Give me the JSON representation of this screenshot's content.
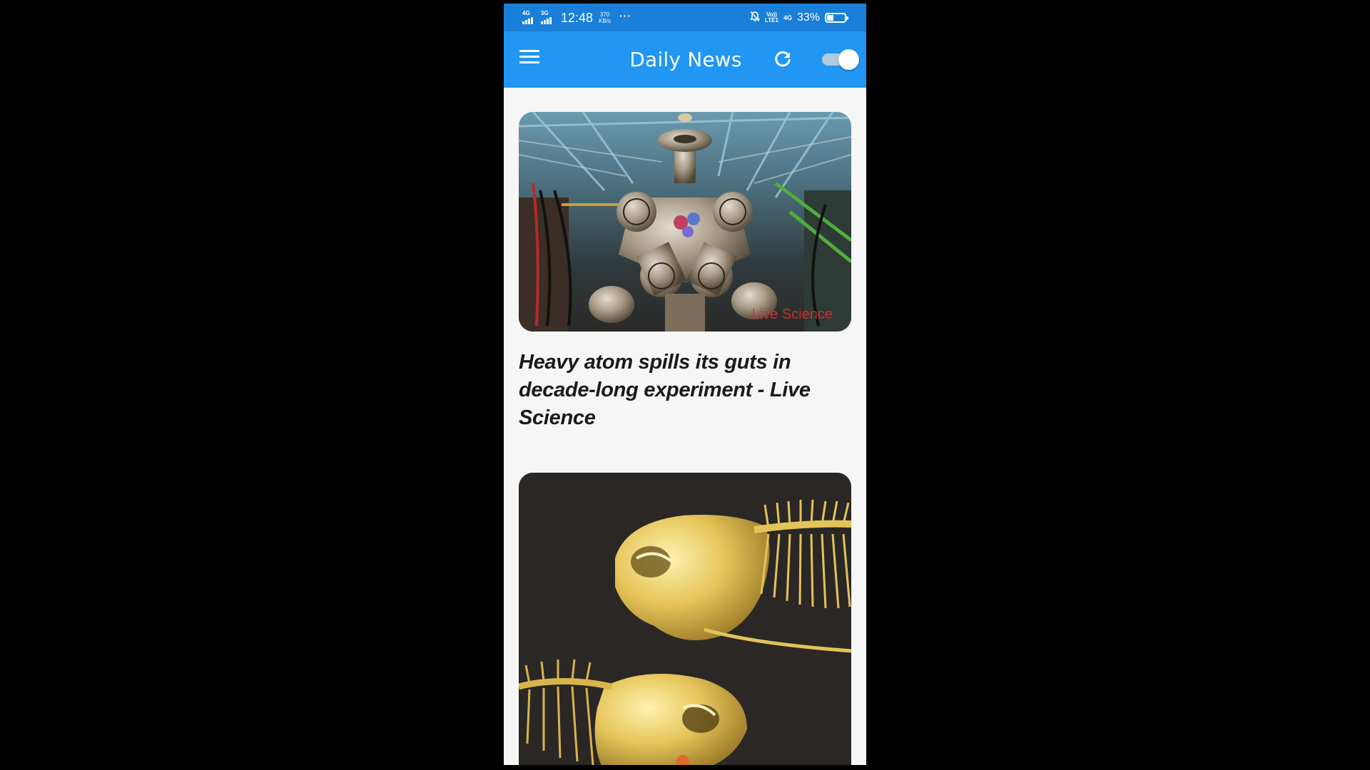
{
  "status_bar": {
    "signal_1_net": "4G",
    "signal_2_net": "3G",
    "time": "12:48",
    "speed_value": "370",
    "speed_unit": "KB/s",
    "more": "···",
    "volte_top": "Vo))",
    "volte_bottom": "LTE1",
    "net_type": "4G",
    "battery_percent": "33%",
    "battery_level": 0.33
  },
  "app_bar": {
    "title": "Daily News",
    "menu_icon": "menu-icon",
    "refresh_icon": "refresh-icon",
    "toggle_state": "on"
  },
  "feed": {
    "articles": [
      {
        "headline": "Heavy atom spills its guts in decade-long experiment - Live Science",
        "image_watermark": "Live Science",
        "image_subject": "particle-detector-photo"
      },
      {
        "headline": "",
        "image_subject": "golden-fish-skeleton-scan"
      }
    ]
  },
  "colors": {
    "status_bar": "#1a7fd8",
    "app_bar": "#2196f3",
    "background": "#f5f6f5",
    "headline_text": "#1a1a1a"
  }
}
